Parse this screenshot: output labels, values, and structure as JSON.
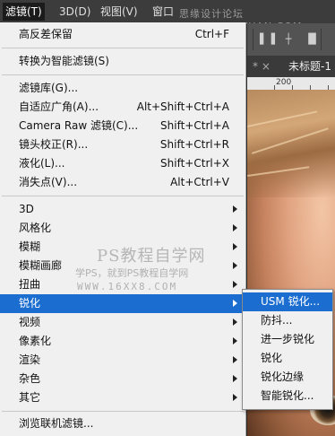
{
  "menubar": {
    "items": [
      "滤镜(T)",
      "3D(D)",
      "视图(V)",
      "窗口"
    ],
    "watermark": "思缘设计论坛 WWW.MISSYUAN.COM"
  },
  "tabs": {
    "inactive": "* ×",
    "active": "未标题-1"
  },
  "ruler": {
    "label": "200"
  },
  "filter_menu": {
    "items": [
      {
        "label": "高反差保留",
        "shortcut": "Ctrl+F"
      },
      {
        "label": "转换为智能滤镜(S)",
        "shortcut": ""
      },
      {
        "label": "滤镜库(G)...",
        "shortcut": ""
      },
      {
        "label": "自适应广角(A)...",
        "shortcut": "Alt+Shift+Ctrl+A"
      },
      {
        "label": "Camera Raw 滤镜(C)...",
        "shortcut": "Shift+Ctrl+A"
      },
      {
        "label": "镜头校正(R)...",
        "shortcut": "Shift+Ctrl+R"
      },
      {
        "label": "液化(L)...",
        "shortcut": "Shift+Ctrl+X"
      },
      {
        "label": "消失点(V)...",
        "shortcut": "Alt+Ctrl+V"
      },
      {
        "label": "3D",
        "shortcut": ""
      },
      {
        "label": "风格化",
        "shortcut": ""
      },
      {
        "label": "模糊",
        "shortcut": ""
      },
      {
        "label": "模糊画廊",
        "shortcut": ""
      },
      {
        "label": "扭曲",
        "shortcut": ""
      },
      {
        "label": "锐化",
        "shortcut": ""
      },
      {
        "label": "视频",
        "shortcut": ""
      },
      {
        "label": "像素化",
        "shortcut": ""
      },
      {
        "label": "渲染",
        "shortcut": ""
      },
      {
        "label": "杂色",
        "shortcut": ""
      },
      {
        "label": "其它",
        "shortcut": ""
      },
      {
        "label": "浏览联机滤镜...",
        "shortcut": ""
      }
    ]
  },
  "sharpen_submenu": {
    "items": [
      "USM 锐化...",
      "防抖...",
      "进一步锐化",
      "锐化",
      "锐化边缘",
      "智能锐化..."
    ]
  },
  "watermark": {
    "line1": "PS教程自学网",
    "line2": "学PS，就到PS教程自学网",
    "line3": "WWW.16XX8.COM"
  },
  "colors": {
    "highlight": "#1c6dd0",
    "menu_bg": "#f0f0f0",
    "menubar_bg": "#3c3c3c"
  }
}
